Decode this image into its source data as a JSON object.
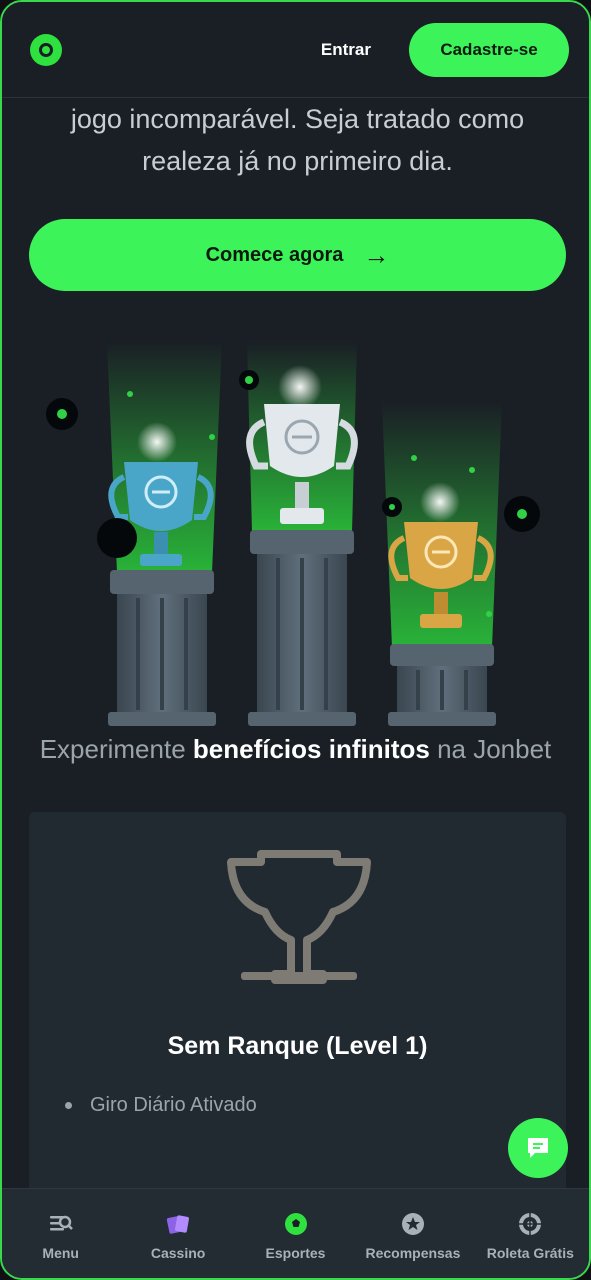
{
  "header": {
    "logo_icon": "jonbet-logo-icon",
    "login_label": "Entrar",
    "signup_label": "Cadastre-se"
  },
  "hero": {
    "line1": "jogo incomparável. Seja tratado como",
    "line2": "realeza já no primeiro dia.",
    "cta_label": "Comece agora",
    "cta_icon": "arrow-right-icon"
  },
  "benefits": {
    "prefix": "Experimente",
    "highlight": "benefícios infinitos",
    "suffix": "na Jonbet"
  },
  "rank_card": {
    "icon": "trophy-outline-icon",
    "title": "Sem Ranque (Level 1)",
    "benefits": [
      "Giro Diário Ativado"
    ]
  },
  "chat": {
    "icon": "chat-icon"
  },
  "nav": {
    "items": [
      {
        "label": "Menu",
        "icon": "menu-icon"
      },
      {
        "label": "Cassino",
        "icon": "cards-icon"
      },
      {
        "label": "Esportes",
        "icon": "soccer-ball-icon"
      },
      {
        "label": "Recompensas",
        "icon": "star-badge-icon"
      },
      {
        "label": "Roleta Grátis",
        "icon": "roulette-icon"
      }
    ]
  },
  "colors": {
    "accent": "#3df35a",
    "background": "#1a1f25",
    "card": "#222a31",
    "nav": "#232b33"
  }
}
